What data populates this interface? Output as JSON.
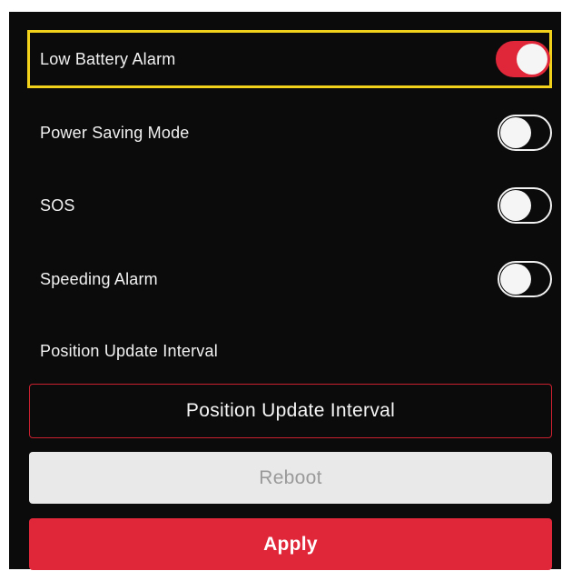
{
  "settings": {
    "low_battery_alarm": {
      "label": "Low Battery Alarm",
      "enabled": true
    },
    "power_saving_mode": {
      "label": "Power Saving Mode",
      "enabled": false
    },
    "sos": {
      "label": "SOS",
      "enabled": false
    },
    "speeding_alarm": {
      "label": "Speeding Alarm",
      "enabled": false
    }
  },
  "position_update": {
    "section_label": "Position Update Interval",
    "button_label": "Position Update Interval"
  },
  "actions": {
    "reboot_label": "Reboot",
    "apply_label": "Apply"
  },
  "colors": {
    "background": "#0b0b0b",
    "accent": "#e0273a",
    "highlight": "#f2d21b",
    "text": "#f2f2f2"
  }
}
